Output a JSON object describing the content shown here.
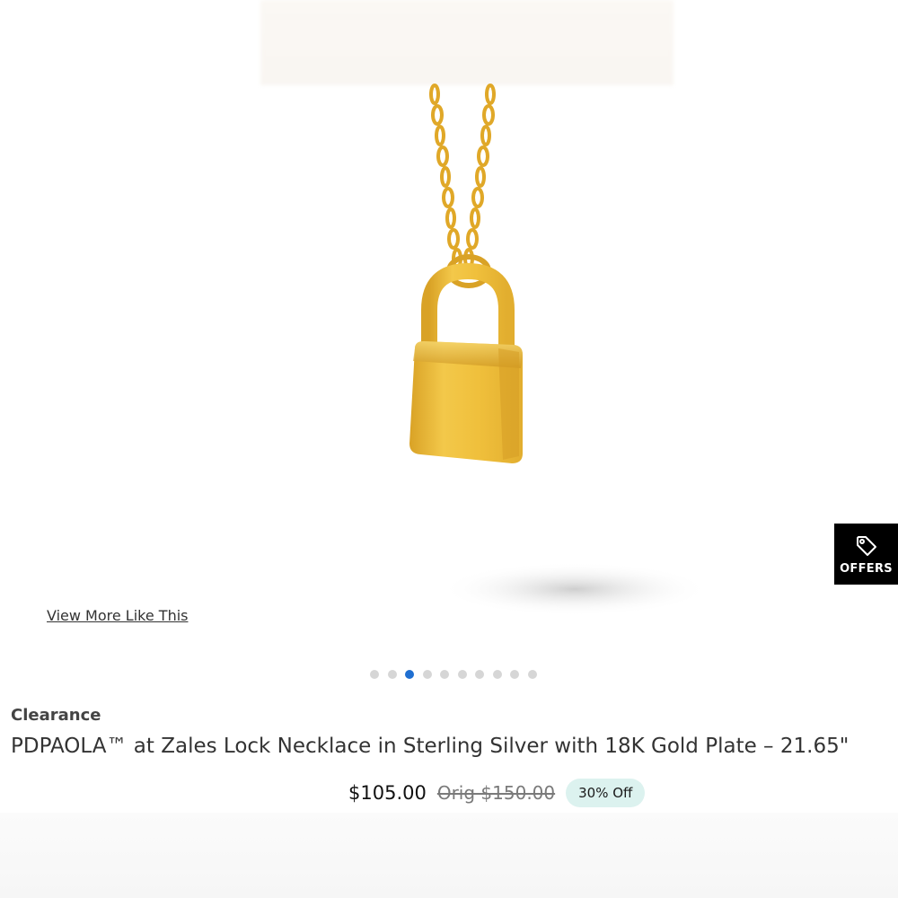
{
  "product": {
    "badge": "Clearance",
    "title": "PDPAOLA™ at Zales Lock Necklace in Sterling Silver with 18K Gold Plate – 21.65\"",
    "price_current": "$105.00",
    "price_original": "Orig $150.00",
    "discount": "30% Off",
    "image_subject": "gold padlock pendant necklace"
  },
  "gallery": {
    "view_more_label": "View More Like This",
    "dot_count": 10,
    "active_dot_index": 2
  },
  "offers_tab": {
    "label": "OFFERS",
    "icon": "price-tag-icon"
  },
  "colors": {
    "active_dot": "#1f6fd1",
    "inactive_dot": "#d6d6d6",
    "discount_badge_bg": "#dcf2ef",
    "offers_bg": "#000000",
    "gold": "#e8b32a"
  }
}
